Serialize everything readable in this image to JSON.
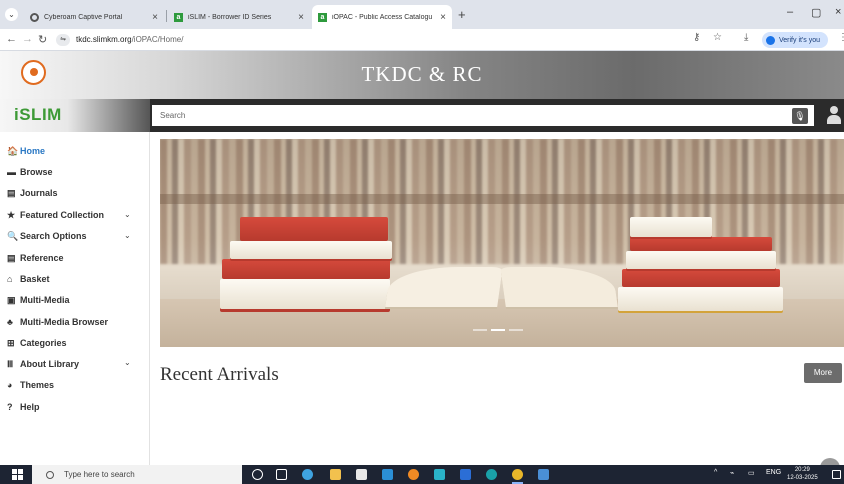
{
  "browser": {
    "tabs": [
      {
        "title": "Cyberoam Captive Portal",
        "close": "×"
      },
      {
        "title": "iSLIM - Borrower ID Series",
        "close": "×"
      },
      {
        "title": "iOPAC - Public Access Catalogu",
        "close": "×"
      }
    ],
    "new_tab": "+",
    "url_host": "tkdc.slimkm.org",
    "url_path": "/iOPAC/Home/",
    "verify_label": "Verify it's you",
    "accent": "#1a73e8"
  },
  "site": {
    "title": "TKDC & RC",
    "brand": "iSLIM",
    "brand_color": "#3d9a36",
    "search_placeholder": "Search"
  },
  "sidebar": {
    "items": [
      {
        "label": "Home",
        "icon": "home-icon",
        "glyph": "🏠"
      },
      {
        "label": "Browse",
        "icon": "browse-icon",
        "glyph": "▬"
      },
      {
        "label": "Journals",
        "icon": "journal-icon",
        "glyph": "▤"
      },
      {
        "label": "Featured Collection",
        "icon": "star-icon",
        "glyph": "★"
      },
      {
        "label": "Search Options",
        "icon": "search-icon",
        "glyph": "🔍"
      },
      {
        "label": "Reference",
        "icon": "reference-icon",
        "glyph": "▤"
      },
      {
        "label": "Basket",
        "icon": "basket-icon",
        "glyph": "⌂"
      },
      {
        "label": "Multi-Media",
        "icon": "multimedia-icon",
        "glyph": "▣"
      },
      {
        "label": "Multi-Media Browser",
        "icon": "multimedia-browser-icon",
        "glyph": "♣"
      },
      {
        "label": "Categories",
        "icon": "categories-icon",
        "glyph": "⊞"
      },
      {
        "label": "About Library",
        "icon": "library-icon",
        "glyph": "Ⅲ"
      },
      {
        "label": "Themes",
        "icon": "themes-icon",
        "glyph": "◕"
      },
      {
        "label": "Help",
        "icon": "help-icon",
        "glyph": "?"
      }
    ],
    "active_color": "#2a78c4"
  },
  "main": {
    "recent_title": "Recent Arrivals",
    "more_label": "More"
  },
  "taskbar": {
    "search_placeholder": "Type here to search",
    "language": "ENG",
    "time": "20:29",
    "date": "12-03-2025"
  }
}
